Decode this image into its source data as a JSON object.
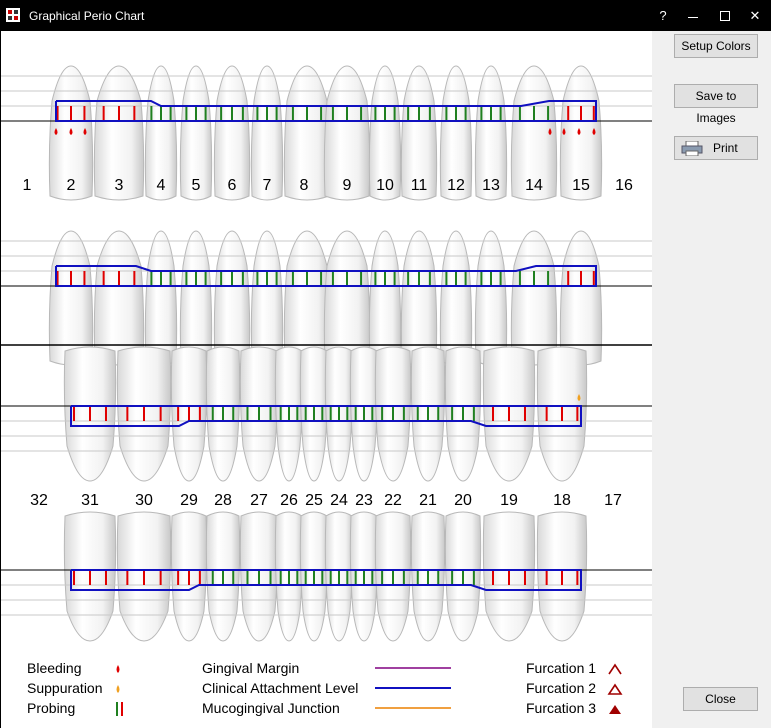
{
  "window": {
    "title": "Graphical Perio Chart",
    "help": "?",
    "minimize": "",
    "maximize": "",
    "close": "✕"
  },
  "buttons": {
    "setup_colors": "Setup Colors",
    "save_images": "Save to Images",
    "print": "Print",
    "close": "Close"
  },
  "upper_numbers": [
    "1",
    "2",
    "3",
    "4",
    "5",
    "6",
    "7",
    "8",
    "9",
    "10",
    "11",
    "12",
    "13",
    "14",
    "15",
    "16"
  ],
  "lower_numbers": [
    "32",
    "31",
    "30",
    "29",
    "28",
    "27",
    "26",
    "25",
    "24",
    "23",
    "22",
    "21",
    "20",
    "19",
    "18",
    "17"
  ],
  "legend": {
    "bleeding": "Bleeding",
    "suppuration": "Suppuration",
    "probing": "Probing",
    "gingival_margin": "Gingival Margin",
    "clinical_attachment": "Clinical Attachment Level",
    "mucogingival": "Mucogingival Junction",
    "furcation1": "Furcation 1",
    "furcation2": "Furcation 2",
    "furcation3": "Furcation 3"
  },
  "colors": {
    "bleeding": "#e00000",
    "suppuration": "#f0a020",
    "probing_healthy": "#208020",
    "probing_deep": "#e00000",
    "gingival_margin": "#a040a0",
    "clinical_attachment": "#1010c0",
    "mucogingival": "#f0a040",
    "furcation": "#a00000"
  }
}
